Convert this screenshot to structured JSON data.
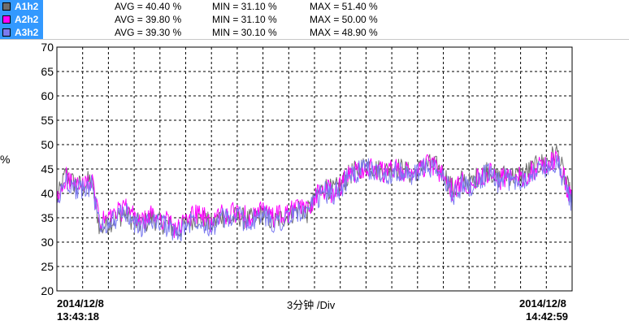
{
  "legend": [
    {
      "name": "A1h2",
      "color": "#6e6e6e",
      "avg": "AVG = 40.40 %",
      "min": "MIN = 31.10 %",
      "max": "MAX = 51.40 %"
    },
    {
      "name": "A2h2",
      "color": "#ff00ff",
      "avg": "AVG = 39.80 %",
      "min": "MIN = 31.10 %",
      "max": "MAX = 50.00 %"
    },
    {
      "name": "A3h2",
      "color": "#7b7bf0",
      "avg": "AVG = 39.30 %",
      "min": "MIN = 30.10 %",
      "max": "MAX = 48.90 %"
    }
  ],
  "footer": {
    "start_date": "2014/12/8",
    "start_time": "13:43:18",
    "end_date": "2014/12/8",
    "end_time": "14:42:59",
    "division": "3分钟 /Div"
  },
  "chart_data": {
    "type": "line",
    "ylabel": "%",
    "ylim": [
      20,
      70
    ],
    "yticks": [
      20,
      25,
      30,
      35,
      40,
      45,
      50,
      55,
      60,
      65,
      70
    ],
    "x_divisions": 20,
    "grid": true,
    "x_start": "2014/12/8 13:43:18",
    "x_end": "2014/12/8 14:42:59",
    "x_unit": "minutes from start",
    "x": [
      0,
      1,
      2,
      3,
      4,
      5,
      6,
      7,
      8,
      9,
      10,
      11,
      12,
      13,
      14,
      15,
      16,
      17,
      18,
      19,
      20,
      21,
      22,
      23,
      24,
      25,
      26,
      27,
      28,
      29,
      30,
      31,
      32,
      33,
      34,
      35,
      36,
      37,
      38,
      39,
      40,
      41,
      42,
      43,
      44,
      45,
      46,
      47,
      48,
      49,
      50,
      51,
      52,
      53,
      54,
      55,
      56,
      57,
      58,
      59,
      59.7
    ],
    "series": [
      {
        "name": "A1h2",
        "color": "#6e6e6e",
        "values": [
          38.5,
          44,
          42,
          41.5,
          43,
          32.5,
          34,
          35,
          36,
          34,
          33.5,
          35,
          34,
          33.5,
          32,
          34,
          35,
          34.5,
          33.5,
          35.5,
          34.5,
          35.5,
          34.5,
          35,
          36,
          34,
          35,
          35.5,
          37,
          36,
          39,
          41.5,
          40.5,
          42,
          44,
          45,
          46,
          45,
          44.5,
          45.5,
          45,
          44,
          45,
          46,
          45.5,
          43.5,
          40.5,
          43,
          42,
          44,
          45,
          43,
          44,
          43.5,
          44,
          45,
          46,
          47,
          48.5,
          42,
          39
        ]
      },
      {
        "name": "A2h2",
        "color": "#ff00ff",
        "values": [
          38,
          43.5,
          41.5,
          41,
          42.5,
          34,
          35,
          36,
          37,
          35,
          34,
          35.5,
          35,
          34,
          32.5,
          34.5,
          36,
          35,
          34,
          36,
          35.5,
          36.5,
          35,
          35.5,
          36.5,
          35,
          35.5,
          36,
          37.5,
          36.5,
          39.5,
          41,
          40,
          42,
          44,
          45,
          45.5,
          45,
          44,
          45,
          44.5,
          44,
          45,
          46,
          45,
          43,
          40,
          42.5,
          42,
          43.5,
          44.5,
          42.5,
          43.5,
          43,
          43.5,
          44.5,
          45.5,
          46,
          47.5,
          41.5,
          38.5
        ]
      },
      {
        "name": "A3h2",
        "color": "#7b7bf0",
        "values": [
          37.5,
          43,
          41,
          40.5,
          42,
          33,
          34,
          35,
          36,
          34,
          33,
          34.5,
          34,
          33,
          31.5,
          33.5,
          35,
          34,
          33,
          35,
          34.5,
          35.5,
          34,
          34.5,
          35.5,
          34,
          34.5,
          35,
          36.5,
          35.5,
          38.5,
          40.5,
          39.5,
          41.5,
          43.5,
          44.5,
          45,
          44.5,
          43.5,
          44.5,
          44,
          43.5,
          44.5,
          45.5,
          44.5,
          42.5,
          39.5,
          42,
          41.5,
          43,
          44,
          42,
          43,
          42.5,
          43,
          44,
          45,
          45.5,
          46.5,
          41,
          38
        ]
      }
    ]
  }
}
